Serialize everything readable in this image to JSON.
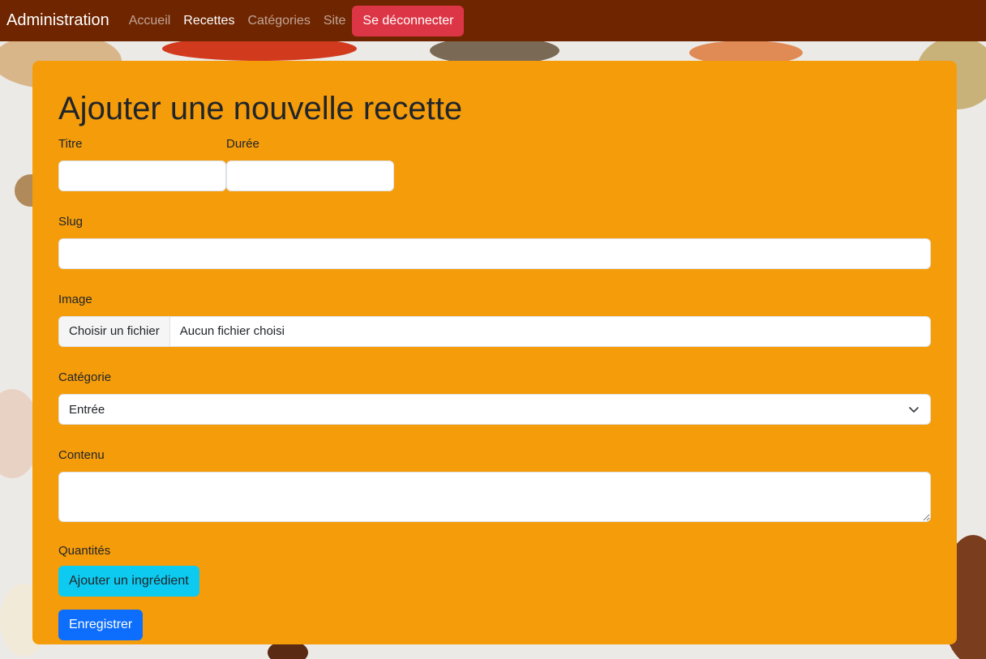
{
  "navbar": {
    "brand": "Administration",
    "links": [
      "Accueil",
      "Recettes",
      "Catégories",
      "Site"
    ],
    "active_link": "Recettes",
    "logout_label": "Se déconnecter"
  },
  "form": {
    "heading": "Ajouter une nouvelle recette",
    "title_label": "Titre",
    "title_value": "",
    "duration_label": "Durée",
    "duration_value": "",
    "slug_label": "Slug",
    "slug_value": "",
    "image_label": "Image",
    "file_button_label": "Choisir un fichier",
    "file_status": "Aucun fichier choisi",
    "category_label": "Catégorie",
    "category_selected": "Entrée",
    "content_label": "Contenu",
    "content_value": "",
    "quantities_label": "Quantités",
    "add_ingredient_label": "Ajouter un ingrédient",
    "save_label": "Enregistrer"
  },
  "colors": {
    "navbar": "#6e2500",
    "card": "#f59c0b",
    "logout": "#dc3545",
    "add_ingredient": "#0dcaf0",
    "save": "#0d6efd"
  }
}
